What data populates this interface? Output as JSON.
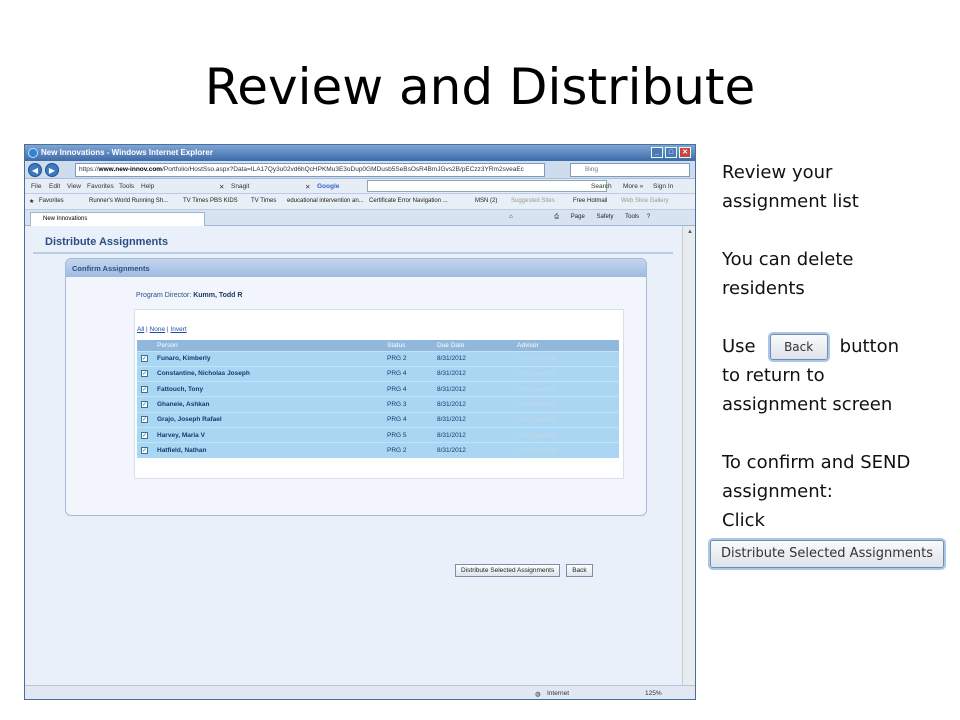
{
  "slide": {
    "title": "Review and Distribute"
  },
  "browser": {
    "window_title": "New Innovations - Windows Internet Explorer",
    "url_prefix": "https://",
    "url_domain": "www.new-innov.com",
    "url_path": "/Portfolio/HostSso.aspx?Data=ILA17Qy3u02vd6hQcHPKMu3E3oDup0GMDusb5SeBsOsR4BmJGvs2B/pECzz3YRm2sveaEc",
    "search_engine": "Bing",
    "menu": [
      "File",
      "Edit",
      "View",
      "Favorites",
      "Tools",
      "Help"
    ],
    "snagit_label": "Snagit",
    "google_label": "Google",
    "search_label": "Search",
    "more_label": "More »",
    "signin_label": "Sign In",
    "favorites_label": "Favorites",
    "favorites": [
      "Runner's World Running Sh...",
      "TV Times PBS KIDS",
      "TV Times",
      "educational intervention an...",
      "Certificate Error Navigation ...",
      "MSN (2)",
      "Suggested Sites",
      "Free Hotmail",
      "Web Slice Gallery"
    ],
    "tab_label": "New Innovations",
    "cmd_page": "Page",
    "cmd_safety": "Safety",
    "cmd_tools": "Tools",
    "status_zone": "Internet",
    "zoom": "125%"
  },
  "page": {
    "header": "Distribute Assignments",
    "panel_title": "Confirm Assignments",
    "director_label": "Program Director:",
    "director_name": "Kumm, Todd R",
    "select_all": "All",
    "select_none": "None",
    "select_invert": "Invert",
    "columns": [
      "Person",
      "Status",
      "Due Date",
      "Advisor"
    ],
    "rows": [
      {
        "person": "Funaro, Kimberly",
        "status": "PRG 2",
        "due": "8/31/2012",
        "advisor": "Not Specified"
      },
      {
        "person": "Constantine, Nicholas Joseph",
        "status": "PRG 4",
        "due": "8/31/2012",
        "advisor": "Not Specified"
      },
      {
        "person": "Fattouch, Tony",
        "status": "PRG 4",
        "due": "8/31/2012",
        "advisor": "Not Specified"
      },
      {
        "person": "Ghaneie, Ashkan",
        "status": "PRG 3",
        "due": "8/31/2012",
        "advisor": "Not Specified"
      },
      {
        "person": "Grajo, Joseph Rafael",
        "status": "PRG 4",
        "due": "8/31/2012",
        "advisor": "Not Specified"
      },
      {
        "person": "Harvey, Maria V",
        "status": "PRG 5",
        "due": "8/31/2012",
        "advisor": "Not Specified"
      },
      {
        "person": "Hatfield, Nathan",
        "status": "PRG 2",
        "due": "8/31/2012",
        "advisor": "Not Specified"
      }
    ],
    "distribute_button": "Distribute Selected Assignments",
    "back_button": "Back"
  },
  "instructions": {
    "line1": "Review your",
    "line2": "assignment list",
    "line3": "You can delete",
    "line4": "residents",
    "use_word": "Use",
    "back_demo": "Back",
    "button_word": "button",
    "line6": "to return to",
    "line7": "assignment screen",
    "line8": "To confirm and SEND",
    "line9": "assignment:",
    "line10": "Click",
    "distribute_demo": "Distribute Selected Assignments"
  }
}
